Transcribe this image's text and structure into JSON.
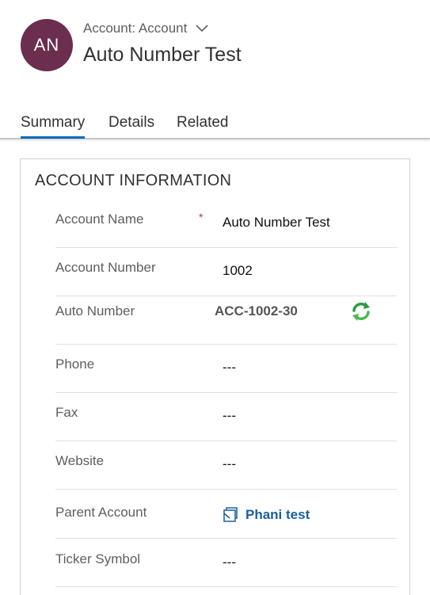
{
  "header": {
    "avatar_initials": "AN",
    "entity_label": "Account: Account",
    "record_title": "Auto Number Test"
  },
  "tabs": [
    {
      "label": "Summary",
      "active": true
    },
    {
      "label": "Details",
      "active": false
    },
    {
      "label": "Related",
      "active": false
    }
  ],
  "section": {
    "title": "ACCOUNT INFORMATION",
    "fields": [
      {
        "label": "Account Name",
        "value": "Auto Number Test",
        "required_mark": "*"
      },
      {
        "label": "Account Number",
        "value": "1002"
      },
      {
        "label": "Auto Number",
        "value": "ACC-1002-30",
        "icon": "refresh-icon"
      },
      {
        "label": "Phone",
        "value": "---"
      },
      {
        "label": "Fax",
        "value": "---"
      },
      {
        "label": "Website",
        "value": "---"
      },
      {
        "label": "Parent Account",
        "value": "Phani test",
        "icon": "lookup-record-icon"
      },
      {
        "label": "Ticker Symbol",
        "value": "---"
      }
    ]
  },
  "colors": {
    "avatar_bg": "#6b2e4e",
    "tab_accent": "#0f6cbd",
    "link": "#1a5fa0",
    "required": "#c4314b",
    "refresh_icon": "#2e9a3b"
  }
}
